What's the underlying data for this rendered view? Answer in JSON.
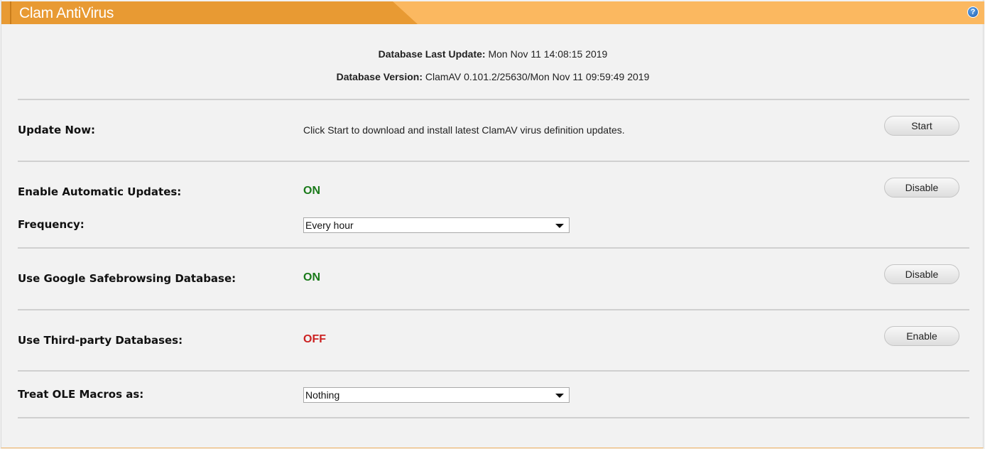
{
  "window": {
    "title": "Clam AntiVirus",
    "help_label": "?"
  },
  "database": {
    "last_update_label": "Database Last Update:",
    "last_update_value": "Mon Nov 11 14:08:15 2019",
    "version_label": "Database Version:",
    "version_value": "ClamAV 0.101.2/25630/Mon Nov 11 09:59:49 2019"
  },
  "update_now": {
    "label": "Update Now:",
    "description": "Click Start to download and install latest ClamAV virus definition updates.",
    "button": "Start"
  },
  "auto_updates": {
    "label": "Enable Automatic Updates:",
    "status": "ON",
    "status_color": "#1a7a1a",
    "button": "Disable",
    "frequency_label": "Frequency:",
    "frequency_value": "Every hour"
  },
  "safebrowsing": {
    "label": "Use Google Safebrowsing Database:",
    "status": "ON",
    "status_color": "#1a7a1a",
    "button": "Disable"
  },
  "third_party": {
    "label": "Use Third-party Databases:",
    "status": "OFF",
    "status_color": "#cc2222",
    "button": "Enable"
  },
  "ole_macros": {
    "label": "Treat OLE Macros as:",
    "value": "Nothing"
  }
}
